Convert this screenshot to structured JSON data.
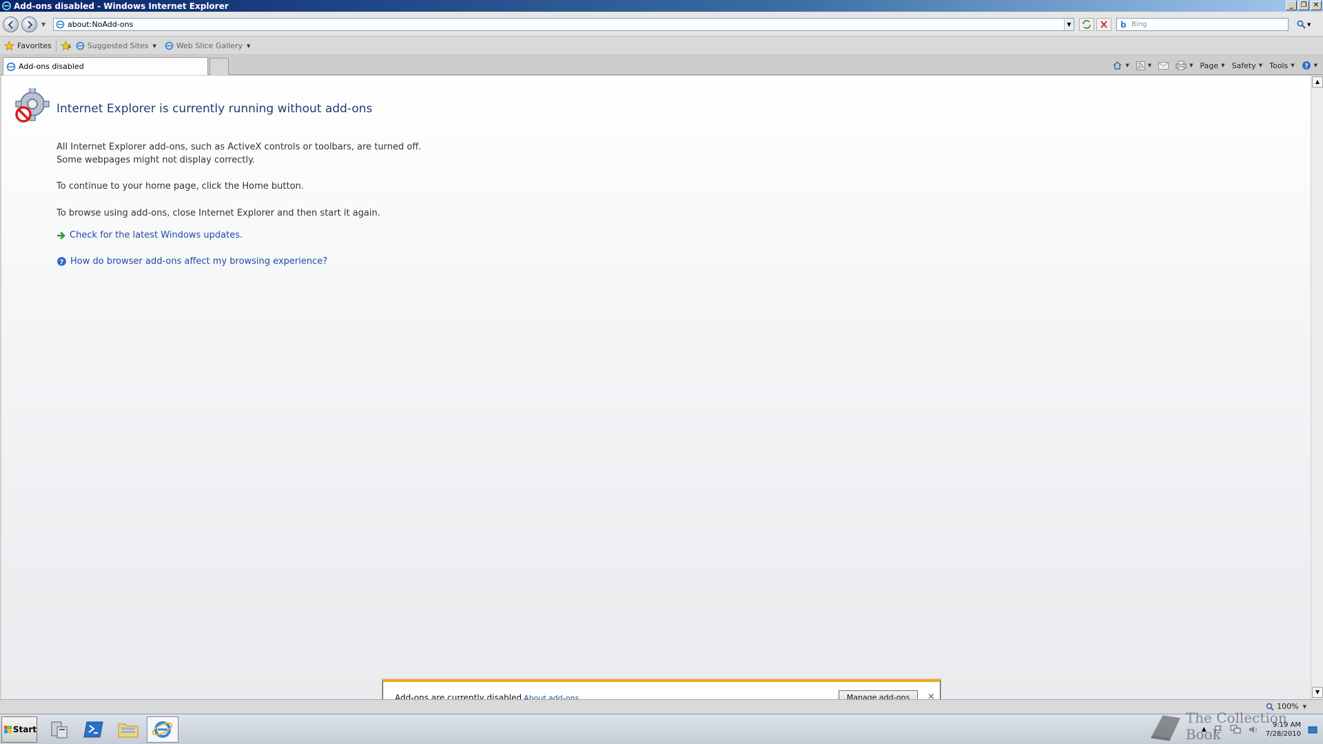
{
  "window": {
    "title": "Add-ons disabled - Windows Internet Explorer"
  },
  "address_bar": {
    "url": "about:NoAdd-ons"
  },
  "search": {
    "placeholder": "Bing"
  },
  "favorites_bar": {
    "favorites_label": "Favorites",
    "items": [
      {
        "label": "Suggested Sites"
      },
      {
        "label": "Web Slice Gallery"
      }
    ]
  },
  "tabs": [
    {
      "label": "Add-ons disabled"
    }
  ],
  "command_bar": {
    "page": "Page",
    "safety": "Safety",
    "tools": "Tools"
  },
  "content": {
    "heading": "Internet Explorer is currently running without add-ons",
    "para1_line1": "All Internet Explorer add-ons, such as ActiveX controls or toolbars, are turned off.",
    "para1_line2": "Some webpages might not display correctly.",
    "para2": "To continue to your home page, click the Home button.",
    "para3": "To browse using add-ons, close Internet Explorer and then start it again.",
    "link1": "Check for the latest Windows updates.",
    "link2": "How do browser add-ons affect my browsing experience?"
  },
  "notification": {
    "message": "Add-ons are currently disabled.",
    "link": "About add-ons",
    "button": "Manage add-ons",
    "close": "×"
  },
  "status_bar": {
    "zoom": "100%"
  },
  "taskbar": {
    "start_label": "Start",
    "clock_time": "9:19 AM",
    "clock_date": "7/28/2010"
  },
  "watermark": "The Collection Book",
  "colors": {
    "title_bar": "#0a246a",
    "heading_text": "#1f3d6d",
    "link": "#1e4b9e",
    "notification_accent": "#f5a623"
  }
}
